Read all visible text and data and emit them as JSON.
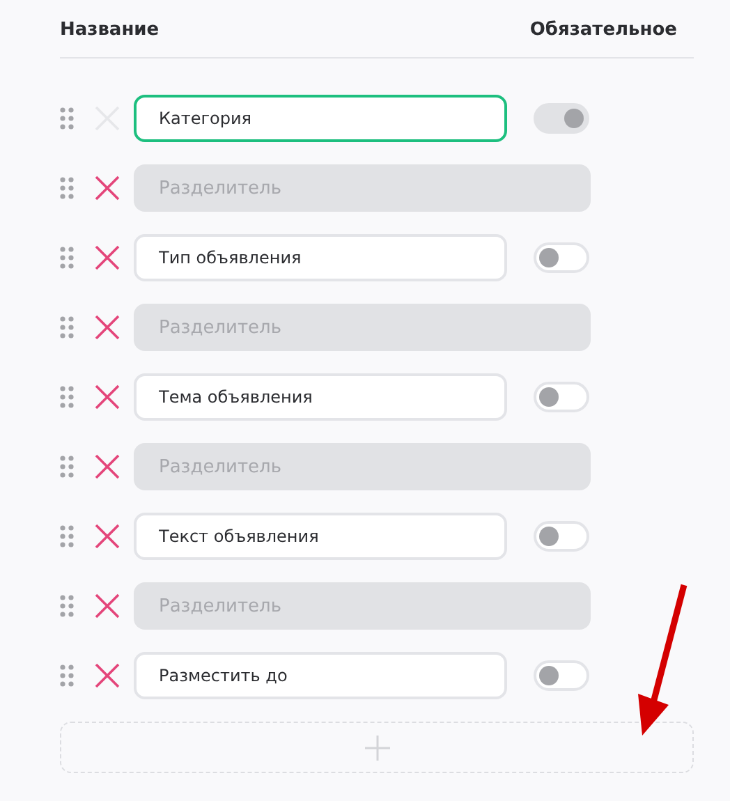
{
  "columns": [
    {
      "label": "Название"
    },
    {
      "label": "Обязательное"
    }
  ],
  "rows": [
    {
      "kind": "field",
      "value": "Категория",
      "focused": true,
      "removable": false,
      "required": true
    },
    {
      "kind": "separator",
      "placeholder": "Разделитель"
    },
    {
      "kind": "field",
      "value": "Тип объявления",
      "focused": false,
      "removable": true,
      "required": false
    },
    {
      "kind": "separator",
      "placeholder": "Разделитель"
    },
    {
      "kind": "field",
      "value": "Тема объявления",
      "focused": false,
      "removable": true,
      "required": false
    },
    {
      "kind": "separator",
      "placeholder": "Разделитель"
    },
    {
      "kind": "field",
      "value": "Текст объявления",
      "focused": false,
      "removable": true,
      "required": false
    },
    {
      "kind": "separator",
      "placeholder": "Разделитель"
    },
    {
      "kind": "field",
      "value": "Разместить до",
      "focused": false,
      "removable": true,
      "required": false
    }
  ]
}
